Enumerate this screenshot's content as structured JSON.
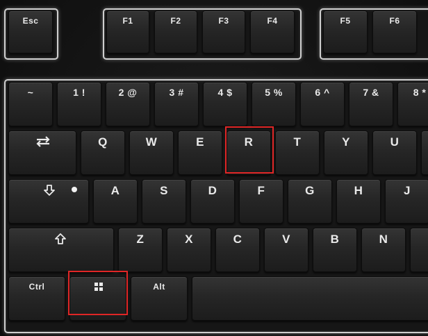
{
  "function_row": {
    "esc": "Esc",
    "f1": "F1",
    "f2": "F2",
    "f3": "F3",
    "f4": "F4",
    "f5": "F5",
    "f6": "F6"
  },
  "number_row": {
    "tilde": "~",
    "k1": "1 !",
    "k2": "2 @",
    "k3": "3 #",
    "k4": "4 $",
    "k5": "5 %",
    "k6": "6 ^",
    "k7": "7 &",
    "k8": "8 *"
  },
  "qwerty_row": {
    "q": "Q",
    "w": "W",
    "e": "E",
    "r": "R",
    "t": "T",
    "y": "Y",
    "u": "U"
  },
  "home_row": {
    "a": "A",
    "s": "S",
    "d": "D",
    "f": "F",
    "g": "G",
    "h": "H",
    "j": "J"
  },
  "bottom_letters": {
    "z": "Z",
    "x": "X",
    "c": "C",
    "v": "V",
    "b": "B",
    "n": "N"
  },
  "modifiers": {
    "ctrl": "Ctrl",
    "alt": "Alt"
  },
  "icons": {
    "tab": "tab-arrows-icon",
    "caps": "caps-lock-arrow-icon",
    "shift": "shift-arrow-icon",
    "windows": "windows-logo-icon"
  },
  "colors": {
    "highlight": "#e02626",
    "backlight": "#cfcfcf"
  }
}
